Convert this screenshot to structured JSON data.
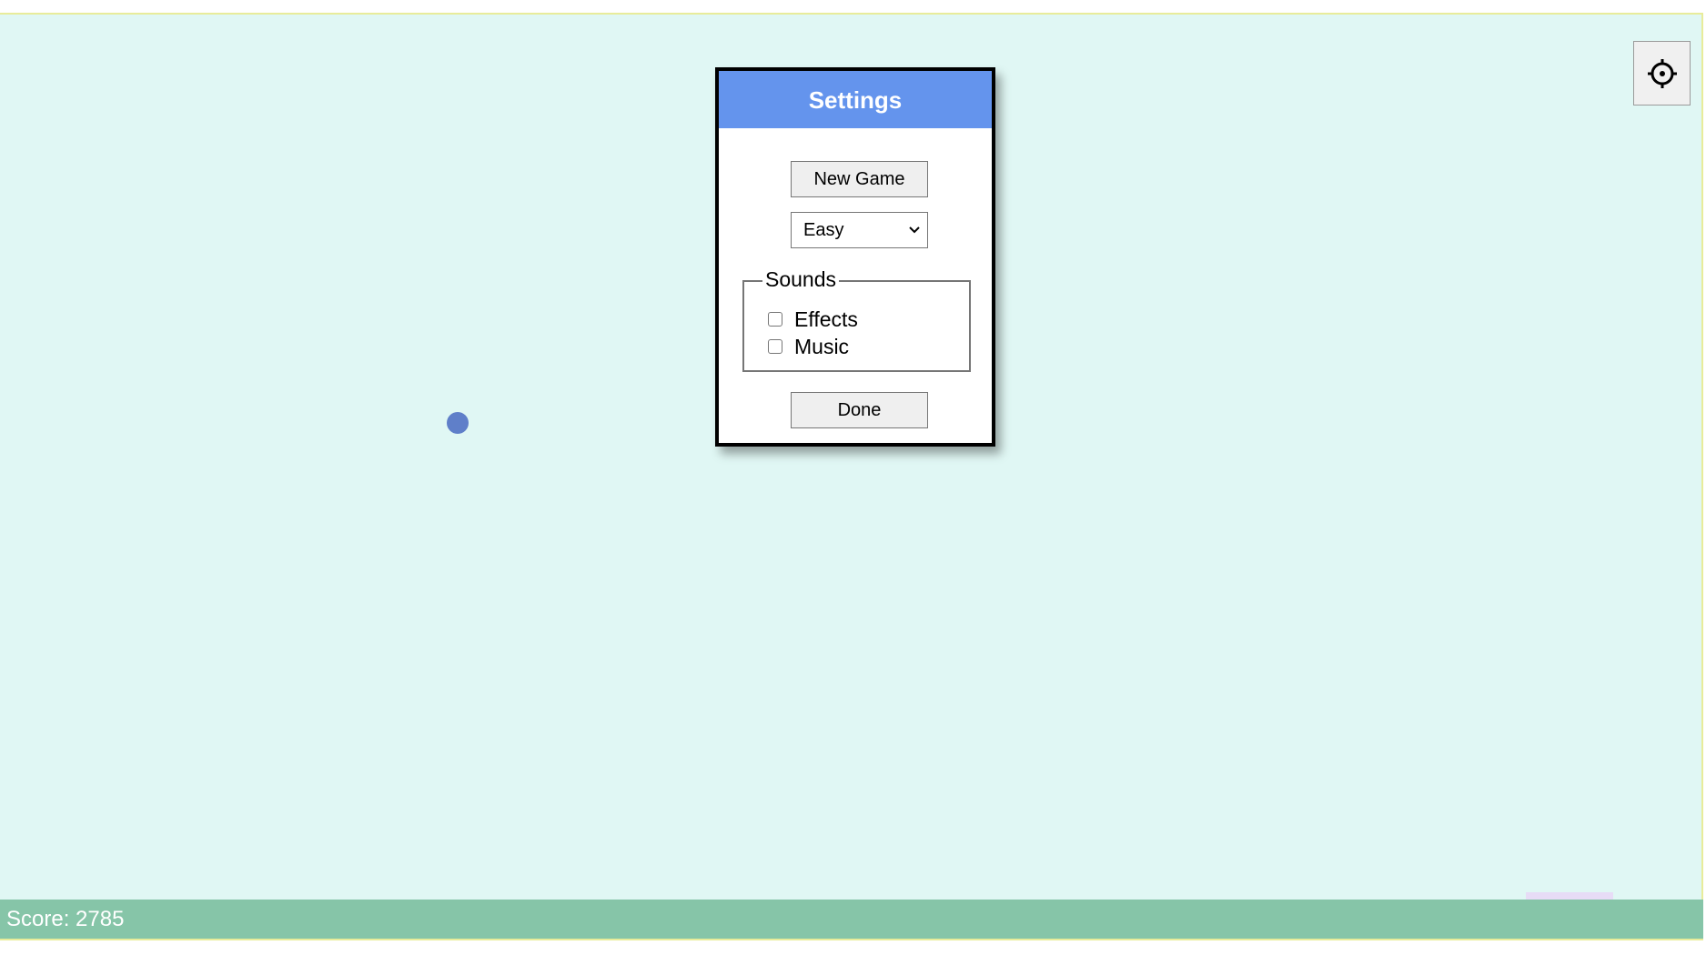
{
  "score": {
    "label": "Score: 2785"
  },
  "settings_dialog": {
    "title": "Settings",
    "new_game_label": "New Game",
    "difficulty": {
      "selected": "Easy"
    },
    "sounds": {
      "legend": "Sounds",
      "options": [
        {
          "label": "Effects",
          "checked": false
        },
        {
          "label": "Music",
          "checked": false
        }
      ]
    },
    "done_label": "Done"
  },
  "icons": {
    "settings_toggle": "gear-icon",
    "select_arrow": "chevron-down-icon"
  },
  "colors": {
    "background": "#e0f7f4",
    "header": "#6494ed",
    "score_bar": "#86c5a8",
    "ball": "#5f7fc9",
    "paddle": "#e7dcf6"
  }
}
